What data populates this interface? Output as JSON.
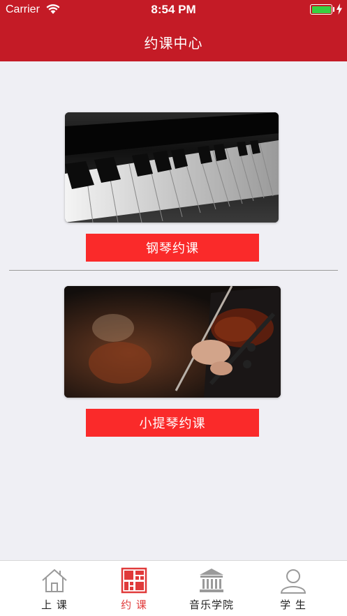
{
  "status_bar": {
    "carrier": "Carrier",
    "time": "8:54 PM",
    "battery_color": "#38d040"
  },
  "nav": {
    "title": "约课中心",
    "background": "#c41b26"
  },
  "courses": [
    {
      "image": "piano-keys-photo",
      "button_label": "钢琴约课"
    },
    {
      "image": "violin-player-photo",
      "button_label": "小提琴约课"
    }
  ],
  "accent": "#fa2a2a",
  "tabbar": {
    "items": [
      {
        "label": "上 课",
        "icon": "home-icon",
        "active": false
      },
      {
        "label": "约 课",
        "icon": "grid-calendar-icon",
        "active": true
      },
      {
        "label": "音乐学院",
        "icon": "academy-building-icon",
        "active": false
      },
      {
        "label": "学 生",
        "icon": "person-icon",
        "active": false
      }
    ],
    "active_color": "#e03a3a"
  }
}
